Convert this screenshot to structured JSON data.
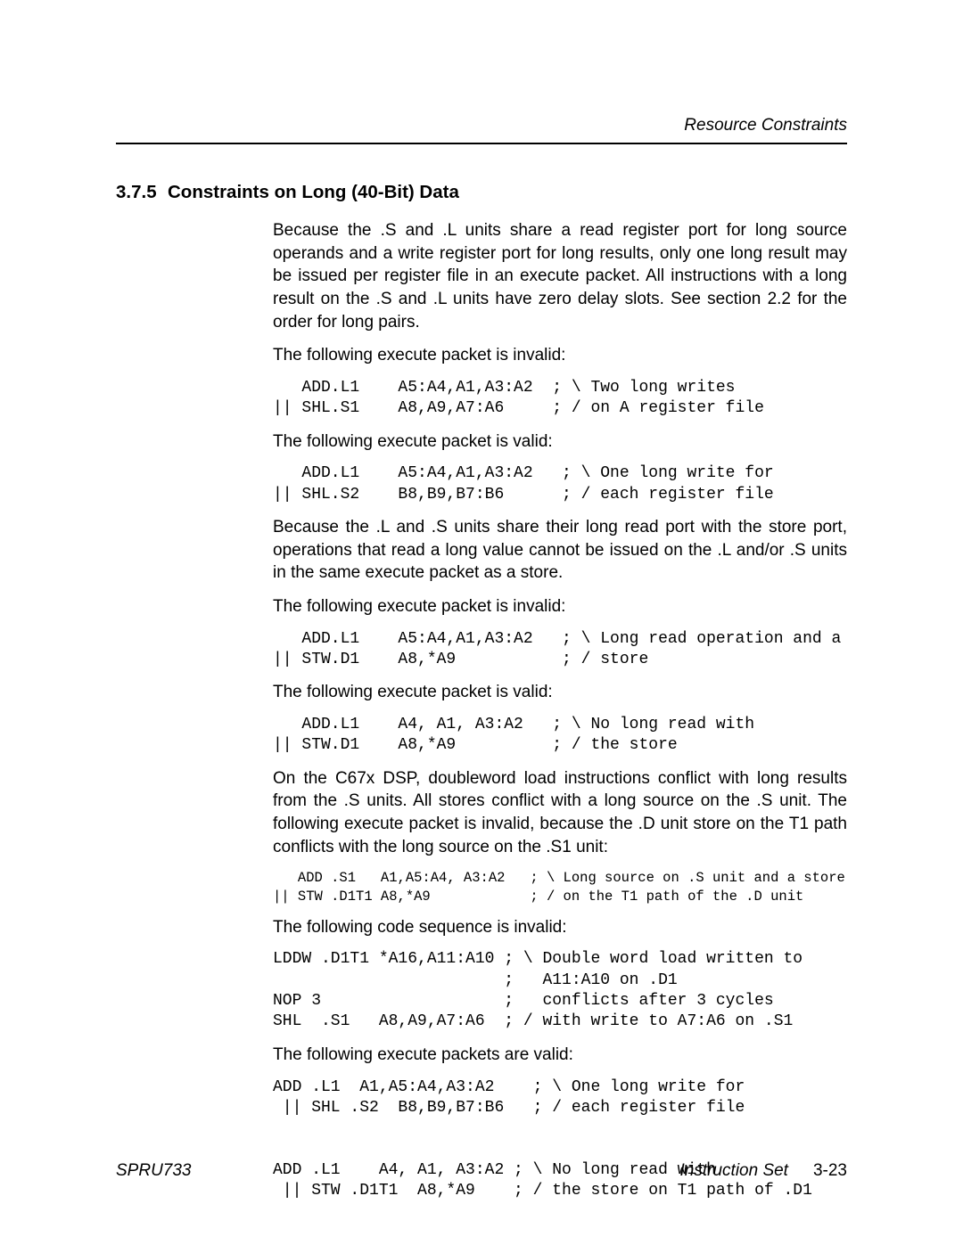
{
  "header": {
    "topic": "Resource Constraints"
  },
  "section": {
    "number": "3.7.5",
    "title": "Constraints on Long (40-Bit) Data"
  },
  "body": {
    "p1": "Because the .S and .L units share a read register port for long source operands and a write register port for long results, only one long result may be issued per register file in an execute packet. All instructions with a long result on the .S and .L units have zero delay slots. See section 2.2 for the order for long pairs.",
    "p2": "The following execute packet is invalid:",
    "code1": "   ADD.L1    A5:A4,A1,A3:A2  ; \\ Two long writes\n|| SHL.S1    A8,A9,A7:A6     ; / on A register file",
    "p3": "The following execute packet is valid:",
    "code2": "   ADD.L1    A5:A4,A1,A3:A2   ; \\ One long write for\n|| SHL.S2    B8,B9,B7:B6      ; / each register file",
    "p4": "Because the .L and .S units share their long read port with the store port, operations that read a long value cannot be issued on the .L and/or .S units in the same execute packet as a store.",
    "p5": "The following execute packet is invalid:",
    "code3": "   ADD.L1    A5:A4,A1,A3:A2   ; \\ Long read operation and a\n|| STW.D1    A8,*A9           ; / store",
    "p6": "The following execute packet is valid:",
    "code4": "   ADD.L1    A4, A1, A3:A2   ; \\ No long read with\n|| STW.D1    A8,*A9          ; / the store",
    "p7": "On the C67x DSP, doubleword load instructions conflict with long results from the .S units. All stores conflict with a long source on the .S unit. The following execute packet is invalid, because the .D unit store on the T1 path conflicts with the long source on the .S1 unit:",
    "code5": "   ADD .S1   A1,A5:A4, A3:A2   ; \\ Long source on .S unit and a store\n|| STW .D1T1 A8,*A9            ; / on the T1 path of the .D unit",
    "p8": "The following code sequence is invalid:",
    "code6": "LDDW .D1T1 *A16,A11:A10 ; \\ Double word load written to\n                        ;   A11:A10 on .D1\nNOP 3                   ;   conflicts after 3 cycles\nSHL  .S1   A8,A9,A7:A6  ; / with write to A7:A6 on .S1",
    "p9": "The following execute packets are valid:",
    "code7": "ADD .L1  A1,A5:A4,A3:A2    ; \\ One long write for\n || SHL .S2  B8,B9,B7:B6   ; / each register file\n\n\nADD .L1    A4, A1, A3:A2 ; \\ No long read with\n || STW .D1T1  A8,*A9    ; / the store on T1 path of .D1"
  },
  "footer": {
    "doc_id": "SPRU733",
    "chapter": "Instruction Set",
    "page": "3-23"
  }
}
